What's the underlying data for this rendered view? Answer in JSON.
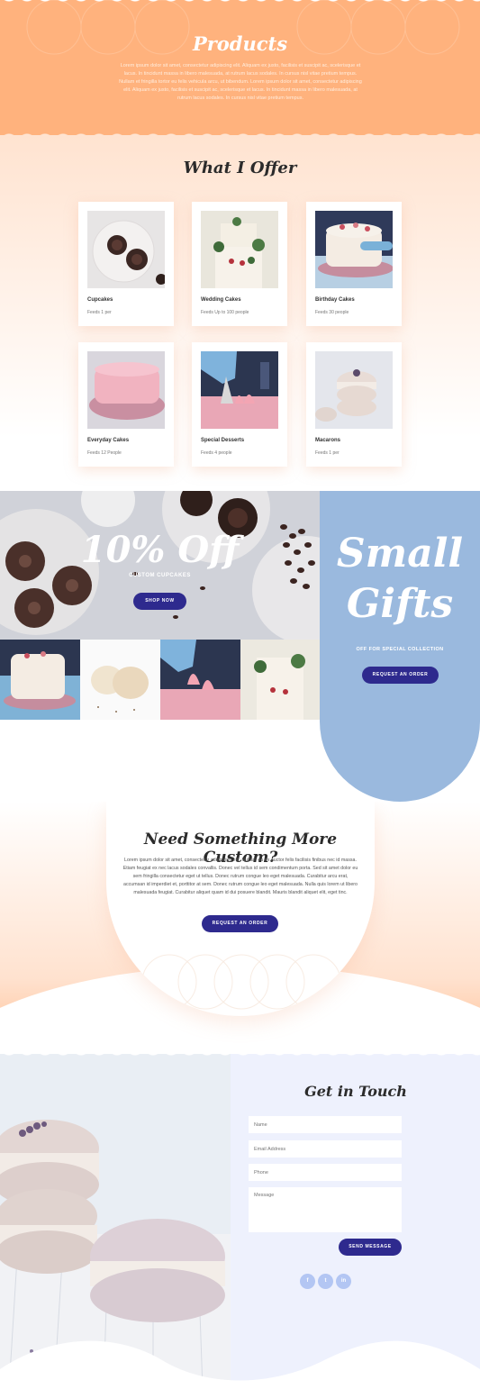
{
  "hero": {
    "title": "Products",
    "text": "Lorem ipsum dolor sit amet, consectetur adipiscing elit. Aliquam ex justo, facilisis et suscipit ac, scelerisque et lacus. In tincidunt massa in libero malesuada, at rutrum lacus sodales. In cursus nisl vitae pretium tempus. Nullam et fringilla tortor eu felis vehicula arcu, ut bibendum. Lorem ipsum dolor sit amet, consectetur adipiscing elit. Aliquam ex justo, facilisis et suscipit ac, scelerisque et lacus. In tincidunt massa in libero malesuada, at rutrum lacus sodales. In cursus nisl vitae pretium tempus."
  },
  "offer": {
    "title": "What I Offer",
    "items": [
      {
        "title": "Cupcakes",
        "meta": "Feeds 1 per"
      },
      {
        "title": "Wedding Cakes",
        "meta": "Feeds Up to 100 people"
      },
      {
        "title": "Birthday Cakes",
        "meta": "Feeds 30 people"
      },
      {
        "title": "Everyday Cakes",
        "meta": "Feeds 12 People"
      },
      {
        "title": "Special Desserts",
        "meta": "Feeds 4 people"
      },
      {
        "title": "Macarons",
        "meta": "Feeds 1 per"
      }
    ]
  },
  "promo": {
    "headline": "10% Off",
    "subline": "CUSTOM CUPCAKES",
    "button": "SHOP NOW"
  },
  "gifts": {
    "title_line1": "Small",
    "title_line2": "Gifts",
    "subline": "OFF FOR SPECIAL COLLECTION",
    "button": "REQUEST AN ORDER"
  },
  "custom": {
    "title": "Need Something More Custom?",
    "text": "Lorem ipsum dolor sit amet, consectetur adipiscing elit. Nullam eu ex auctor felis facilisis finibus nec id massa. Etiam feugiat ex nec lacus sodales convallis. Donec vel tellus id sem condimentum porta. Sed sit amet dolor eu sem fringilla consectetur eget ut tellus. Donec rutrum congue leo eget malesuada. Curabitur arcu erat, accumsan id imperdiet et, porttitor at sem. Donec rutrum congue leo eget malesuada. Nulla quis lorem ut libero malesuada feugiat. Curabitur aliquet quam id dui posuere blandit. Mauris blandit aliquet elit, eget tinc.",
    "button": "REQUEST AN ORDER"
  },
  "contact": {
    "title": "Get in Touch",
    "name_placeholder": "Name",
    "email_placeholder": "Email Address",
    "phone_placeholder": "Phone",
    "message_placeholder": "Message",
    "send_button": "SEND MESSAGE",
    "social": [
      {
        "icon": "facebook-icon",
        "glyph": "f"
      },
      {
        "icon": "twitter-icon",
        "glyph": "t"
      },
      {
        "icon": "linkedin-icon",
        "glyph": "in"
      }
    ]
  },
  "colors": {
    "hero_peach": "#ffb27d",
    "accent_navy": "#2e2a8e",
    "gifts_blue": "#9ab9de",
    "contact_bg": "#eef1fd"
  }
}
